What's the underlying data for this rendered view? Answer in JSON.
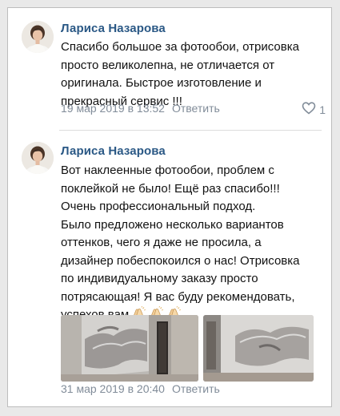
{
  "comments": [
    {
      "author": "Лариса Назарова",
      "lines": [
        "Спасибо большое за фотообои, отрисовка",
        "просто великолепна, не отличается от",
        "оригинала. Быстрое изготовление и",
        "прекрасный сервис !!!"
      ],
      "date": "19 мар 2019 в 13:52",
      "reply_label": "Ответить",
      "likes": "1"
    },
    {
      "author": "Лариса Назарова",
      "lines": [
        "Вот наклеенные фотообои, проблем с",
        "поклейкой не было! Ещё раз спасибо!!!",
        "Очень профессиональный подход.",
        "Было предложено несколько вариантов",
        "оттенков, чего я даже не просила, а",
        "дизайнер побеспокоился о нас! Отрисовка",
        "по индивидуальному заказу просто",
        "потрясающая! Я вас буду рекомендовать,",
        "успехов вам"
      ],
      "emoji": "clapping-hands-icon",
      "date": "31 мар 2019 в 20:40",
      "reply_label": "Ответить"
    }
  ],
  "colors": {
    "author": "#2a5885",
    "meta": "#818c99",
    "text": "#111111"
  }
}
